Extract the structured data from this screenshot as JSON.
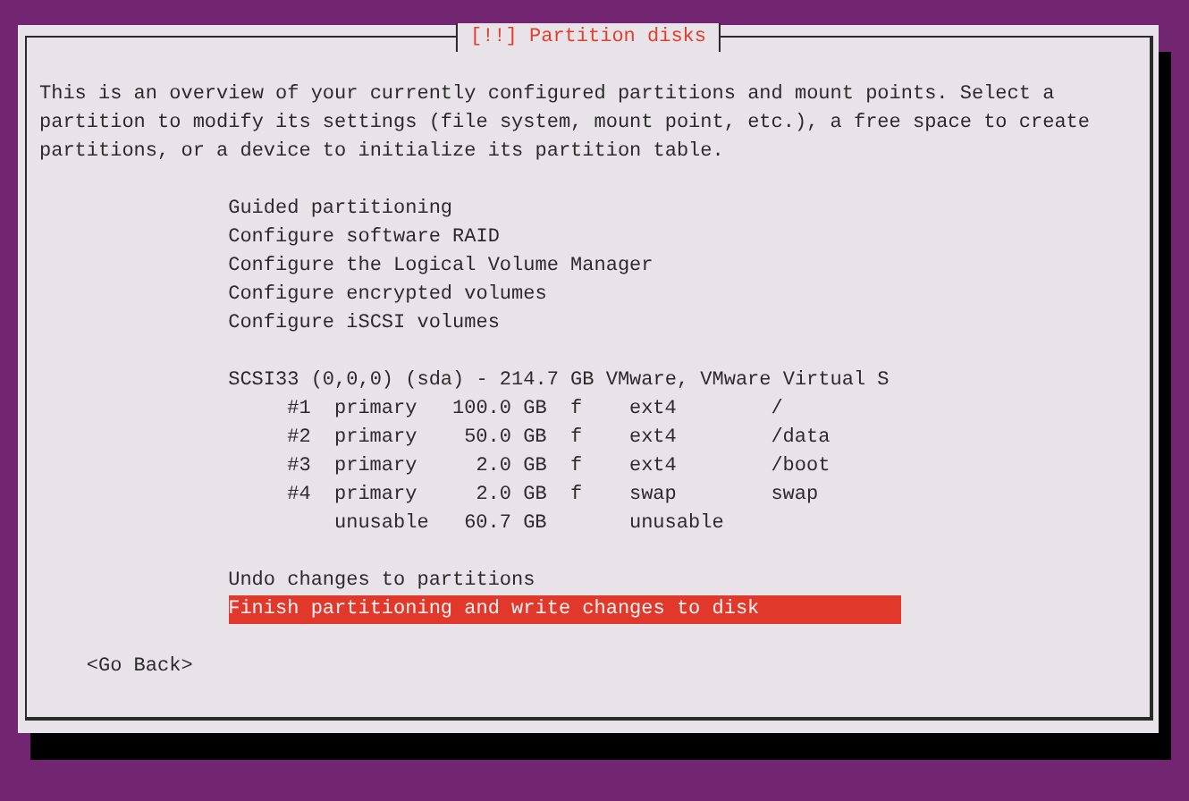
{
  "dialog": {
    "title": "[!!] Partition disks",
    "description": "This is an overview of your currently configured partitions and mount points. Select a partition to modify its settings (file system, mount point, etc.), a free space to create partitions, or a device to initialize its partition table.",
    "menu_items": [
      {
        "label": "Guided partitioning",
        "selected": false
      },
      {
        "label": "Configure software RAID",
        "selected": false
      },
      {
        "label": "Configure the Logical Volume Manager",
        "selected": false
      },
      {
        "label": "Configure encrypted volumes",
        "selected": false
      },
      {
        "label": "Configure iSCSI volumes",
        "selected": false
      }
    ],
    "disk": {
      "label": "SCSI33 (0,0,0) (sda) - 214.7 GB VMware, VMware Virtual S",
      "partitions": [
        {
          "number": "#1",
          "type": "primary",
          "size": "100.0 GB",
          "flag": "f",
          "filesystem": "ext4",
          "mount": "/"
        },
        {
          "number": "#2",
          "type": "primary",
          "size": "50.0 GB",
          "flag": "f",
          "filesystem": "ext4",
          "mount": "/data"
        },
        {
          "number": "#3",
          "type": "primary",
          "size": "2.0 GB",
          "flag": "f",
          "filesystem": "ext4",
          "mount": "/boot"
        },
        {
          "number": "#4",
          "type": "primary",
          "size": "2.0 GB",
          "flag": "f",
          "filesystem": "swap",
          "mount": "swap"
        },
        {
          "type": "unusable",
          "size": "60.7 GB",
          "filesystem": "unusable"
        }
      ]
    },
    "actions": [
      {
        "label": "Undo changes to partitions",
        "selected": false
      },
      {
        "label": "Finish partitioning and write changes to disk",
        "selected": true
      }
    ],
    "back_button": "<Go Back>"
  }
}
